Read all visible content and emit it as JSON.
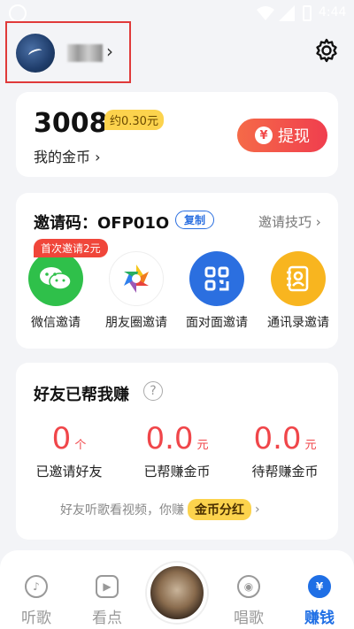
{
  "status_bar": {
    "time": "4:44"
  },
  "profile": {
    "chevron": "›"
  },
  "coins": {
    "amount": "3008",
    "approx": "约0.30元",
    "label": "我的金币 ›",
    "withdraw_label": "提现",
    "yen_symbol": "¥"
  },
  "invite": {
    "title": "邀请码：OFP01O",
    "copy_label": "复制",
    "tips_label": "邀请技巧 ›",
    "first_badge": "首次邀请2元",
    "items": [
      {
        "label": "微信邀请",
        "icon": "wechat-icon",
        "color": "#2fc04a"
      },
      {
        "label": "朋友圈邀请",
        "icon": "moments-icon",
        "color": "#ffffff"
      },
      {
        "label": "面对面邀请",
        "icon": "qrcode-icon",
        "color": "#2b6fe0"
      },
      {
        "label": "通讯录邀请",
        "icon": "contacts-icon",
        "color": "#f8b51f"
      }
    ]
  },
  "earn": {
    "title": "好友已帮我赚",
    "help": "?",
    "stats": [
      {
        "value": "0",
        "unit": "个",
        "label": "已邀请好友"
      },
      {
        "value": "0.0",
        "unit": "元",
        "label": "已帮赚金币"
      },
      {
        "value": "0.0",
        "unit": "元",
        "label": "待帮赚金币"
      }
    ],
    "note": "好友听歌看视频，你赚",
    "tag": "金币分红",
    "note_chevron": "›"
  },
  "nav": {
    "items": [
      {
        "label": "听歌",
        "icon": "music-icon",
        "glyph": "♪"
      },
      {
        "label": "看点",
        "icon": "play-icon",
        "glyph": "▶"
      },
      {
        "label": "唱歌",
        "icon": "mic-icon",
        "glyph": "◉"
      },
      {
        "label": "赚钱",
        "icon": "yen-icon",
        "glyph": "¥"
      }
    ],
    "active_color": "#1f6fe5"
  }
}
